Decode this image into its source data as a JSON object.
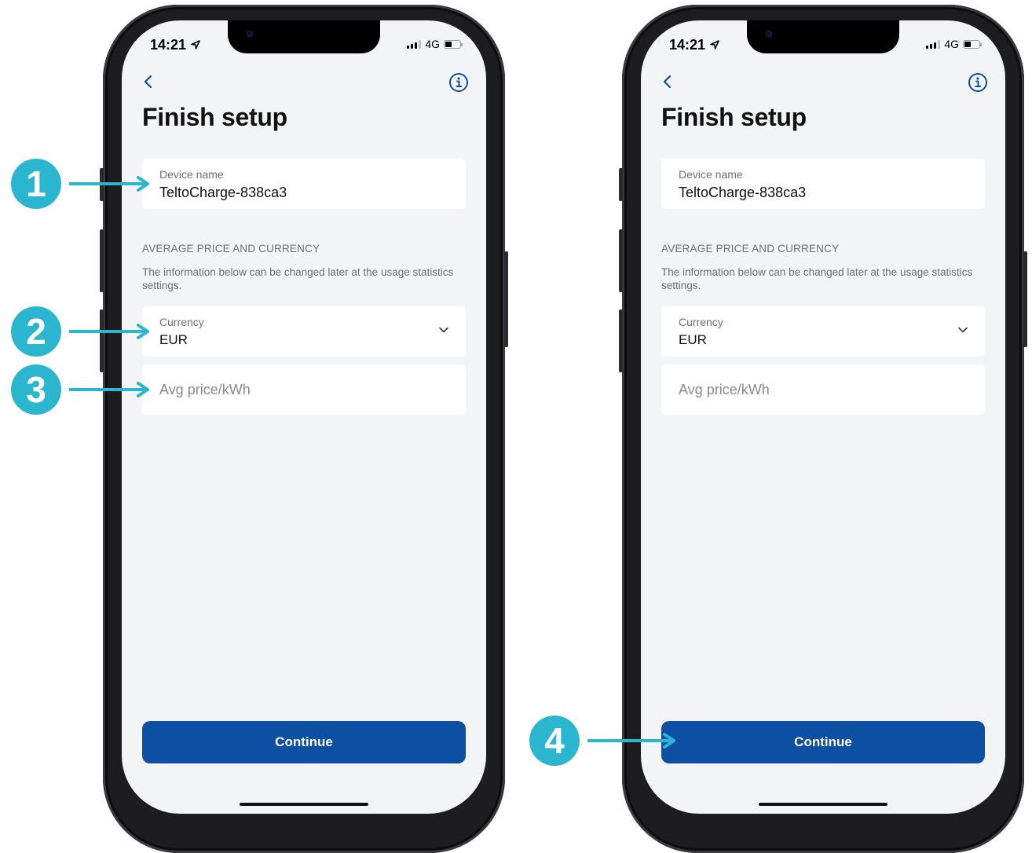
{
  "screen": {
    "status_time": "14:21",
    "network": "4G",
    "title": "Finish setup",
    "device_name": {
      "label": "Device name",
      "value": "TeltoCharge-838ca3"
    },
    "section_heading": "AVERAGE PRICE AND CURRENCY",
    "section_description": "The information below can be changed later at the usage statistics settings.",
    "currency": {
      "label": "Currency",
      "value": "EUR"
    },
    "avg_price": {
      "placeholder": "Avg price/kWh"
    },
    "continue_label": "Continue"
  },
  "markers": [
    "1",
    "2",
    "3",
    "4"
  ],
  "colors": {
    "accent": "#0d4fa3",
    "marker": "#2bb6cf",
    "background": "#f3f4f6"
  },
  "icons": [
    "back-chevron-icon",
    "info-icon",
    "chevron-down-icon",
    "location-arrow-icon",
    "signal-icon",
    "battery-icon"
  ]
}
